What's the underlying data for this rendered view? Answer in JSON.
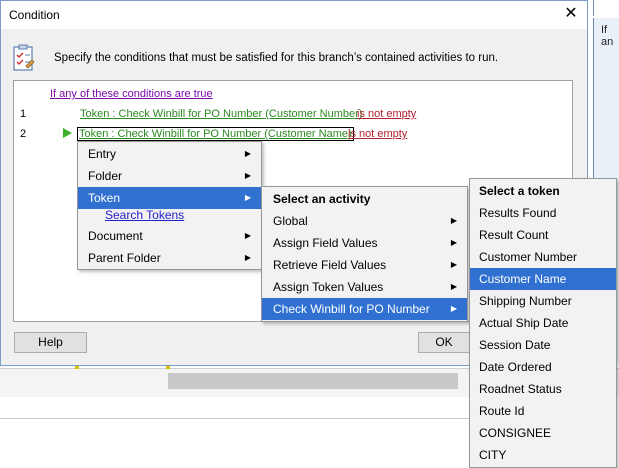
{
  "dialog": {
    "title": "Condition",
    "close_glyph": "✕",
    "info_text": "Specify the conditions that must be satisfied for this branch’s contained activities to run.",
    "conditions_header": "If any of these conditions are true",
    "rows": [
      {
        "num": "1",
        "token": "Token : Check Winbill for PO Number (Customer Number)",
        "operator": "is not empty"
      },
      {
        "num": "2",
        "token": "Token : Check Winbill for PO Number (Customer Name)",
        "operator": "is not empty"
      }
    ],
    "help_label": "Help",
    "ok_label": "OK"
  },
  "background": {
    "right_panel_text": "If an"
  },
  "context_menu": {
    "items": [
      "Entry",
      "Folder",
      "Token",
      "Search Tokens",
      "Document",
      "Parent Folder"
    ],
    "highlighted": "Token"
  },
  "activity_menu": {
    "header": "Select an activity",
    "items": [
      "Global",
      "Assign Field Values",
      "Retrieve Field Values",
      "Assign Token Values",
      "Check Winbill for PO Number"
    ],
    "highlighted": "Check Winbill for PO Number"
  },
  "token_menu": {
    "header": "Select a token",
    "items": [
      "Results Found",
      "Result Count",
      "Customer Number",
      "Customer Name",
      "Shipping Number",
      "Actual Ship Date",
      "Session Date",
      "Date Ordered",
      "Roadnet Status",
      "Route Id",
      "CONSIGNEE",
      "CITY"
    ],
    "highlighted": "Customer Name"
  },
  "colors": {
    "highlight": "#3070d0",
    "token_green": "#2b8a20",
    "operator_red": "#b0202f",
    "header_purple": "#7a0aa8"
  }
}
